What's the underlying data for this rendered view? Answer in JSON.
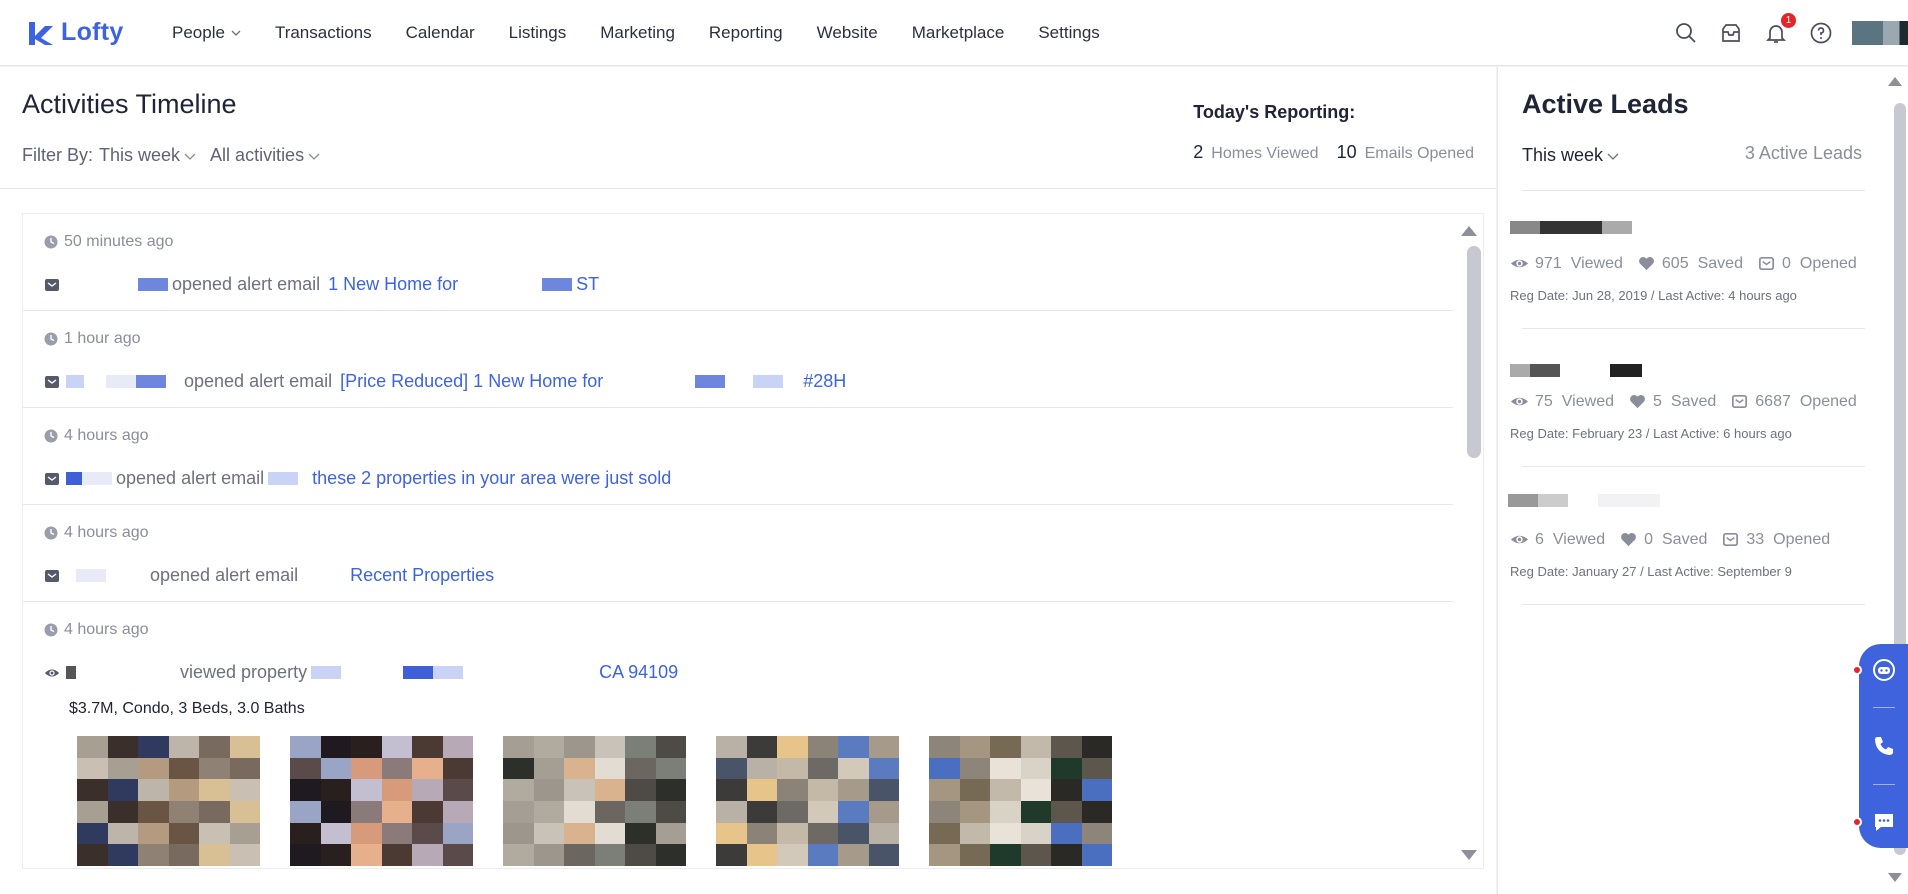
{
  "nav": {
    "logo_text": "Lofty",
    "items": [
      "People",
      "Transactions",
      "Calendar",
      "Listings",
      "Marketing",
      "Reporting",
      "Website",
      "Marketplace",
      "Settings"
    ],
    "notification_count": "1"
  },
  "left": {
    "title": "Activities Timeline",
    "filter_label": "Filter By:",
    "filter_period": "This week",
    "filter_activity": "All activities",
    "reporting_title": "Today's Reporting:",
    "homes_viewed_count": "2",
    "homes_viewed_label": "Homes Viewed",
    "emails_opened_count": "10",
    "emails_opened_label": "Emails Opened"
  },
  "activities": [
    {
      "time": "50 minutes ago",
      "action": "opened alert email",
      "link": "1 New Home for",
      "link_tail": "ST"
    },
    {
      "time": "1 hour ago",
      "action": "opened alert email",
      "link": "[Price Reduced] 1 New Home for",
      "link_tail": "#28H"
    },
    {
      "time": "4 hours ago",
      "action": "opened alert email",
      "link": "these 2 properties in your area were just sold"
    },
    {
      "time": "4 hours ago",
      "action": "opened alert email",
      "link": "Recent Properties"
    },
    {
      "time": "4 hours ago",
      "action": "viewed property",
      "link": "CA 94109",
      "details": "$3.7M, Condo, 3 Beds, 3.0 Baths"
    }
  ],
  "right": {
    "title": "Active Leads",
    "filter_period": "This week",
    "active_count": "3 Active Leads",
    "viewed_label": "Viewed",
    "saved_label": "Saved",
    "opened_label": "Opened"
  },
  "leads": [
    {
      "viewed": "971",
      "saved": "605",
      "opened": "0",
      "reg": "Reg Date: Jun 28, 2019 / Last Active: 4 hours ago"
    },
    {
      "viewed": "75",
      "saved": "5",
      "opened": "6687",
      "reg": "Reg Date: February 23 / Last Active: 6 hours ago"
    },
    {
      "viewed": "6",
      "saved": "0",
      "opened": "33",
      "reg": "Reg Date: January 27 / Last Active: September 9"
    }
  ],
  "colors": {
    "brand": "#3d63e0",
    "badge": "#e5252a",
    "widget": "#3f63dc"
  },
  "icons": [
    "search-icon",
    "inbox-icon",
    "bell-icon",
    "help-icon",
    "clock-icon",
    "email-icon",
    "eye-icon",
    "heart-icon",
    "chat-icon",
    "phone-icon",
    "message-icon"
  ]
}
